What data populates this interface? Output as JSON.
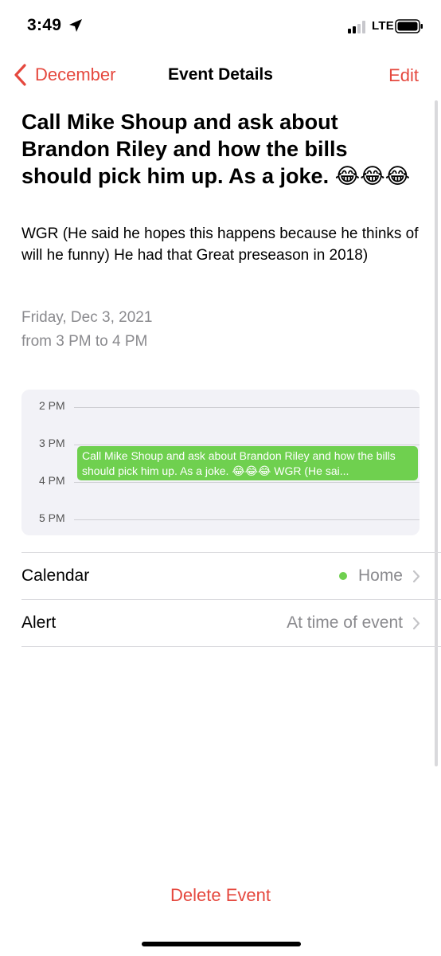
{
  "status_bar": {
    "time": "3:49",
    "network": "LTE",
    "icons": [
      "location-arrow-icon",
      "cell-signal-icon",
      "battery-icon"
    ]
  },
  "nav": {
    "back_label": "December",
    "title": "Event Details",
    "edit_label": "Edit"
  },
  "event": {
    "title": "Call Mike Shoup and ask about Brandon Riley and how the bills should pick him up. As a joke. 😂😂😂",
    "notes": "WGR (He said he hopes this happens because he thinks of will he funny) He had that Great preseason in 2018)",
    "date_line": "Friday, Dec 3, 2021",
    "time_line": "from 3 PM to 4 PM"
  },
  "timeline": {
    "hours": [
      "2 PM",
      "3 PM",
      "4 PM",
      "5 PM"
    ],
    "event_text": "Call Mike Shoup and ask about Brandon Riley and how the bills should pick him up. As a joke. 😂😂😂 WGR (He sai..."
  },
  "rows": {
    "calendar_label": "Calendar",
    "calendar_value": "Home",
    "alert_label": "Alert",
    "alert_value": "At time of event"
  },
  "actions": {
    "delete_label": "Delete Event"
  },
  "colors": {
    "accent": "#e5483e",
    "event_green": "#6fd04f",
    "secondary_text": "#8a8a8e"
  }
}
